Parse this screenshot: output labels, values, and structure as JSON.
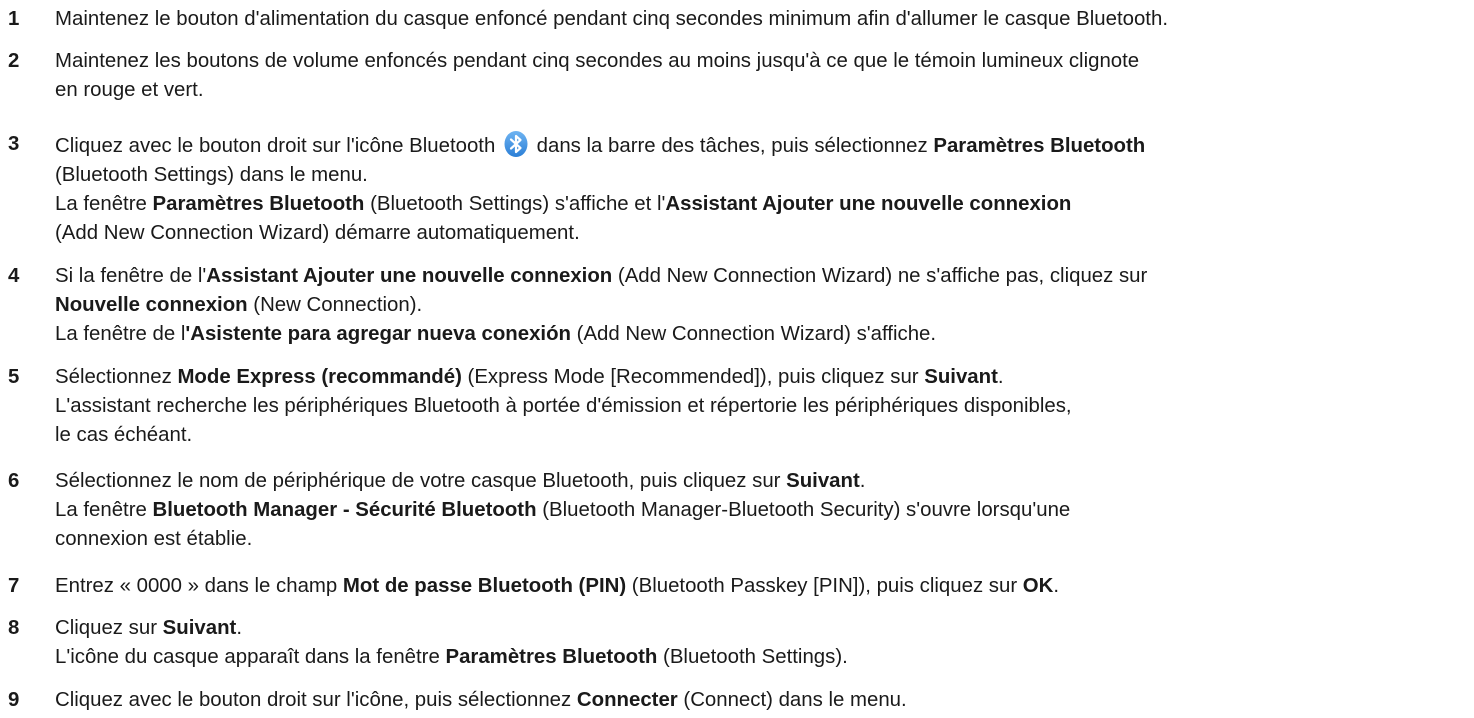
{
  "steps": [
    {
      "number": "1",
      "lines": [
        [
          {
            "t": "Maintenez le bouton d'alimentation du casque enfoncé pendant cinq secondes minimum afin d'allumer le casque Bluetooth."
          }
        ]
      ]
    },
    {
      "number": "2",
      "lines": [
        [
          {
            "t": "Maintenez les boutons de volume enfoncés pendant cinq secondes au moins jusqu'à ce que le témoin lumineux clignote"
          }
        ],
        [
          {
            "t": "en rouge et vert."
          }
        ]
      ]
    },
    {
      "number": "3",
      "lines": [
        [
          {
            "t": "Cliquez avec le bouton droit sur l'icône Bluetooth "
          },
          {
            "icon": "bluetooth-icon"
          },
          {
            "t": " dans la barre des tâches, puis sélectionnez "
          },
          {
            "t": "Paramètres Bluetooth",
            "b": true
          }
        ],
        [
          {
            "t": "(Bluetooth Settings) dans le menu."
          }
        ],
        [
          {
            "t": "La fenêtre "
          },
          {
            "t": "Paramètres Bluetooth",
            "b": true
          },
          {
            "t": " (Bluetooth Settings) s'affiche et l'"
          },
          {
            "t": "Assistant Ajouter une nouvelle connexion",
            "b": true
          }
        ],
        [
          {
            "t": "(Add New Connection Wizard) démarre automatiquement."
          }
        ]
      ]
    },
    {
      "number": "4",
      "lines": [
        [
          {
            "t": "Si la fenêtre de l'"
          },
          {
            "t": "Assistant Ajouter une nouvelle connexion",
            "b": true
          },
          {
            "t": " (Add New Connection Wizard) ne s'affiche pas, cliquez sur"
          }
        ],
        [
          {
            "t": "Nouvelle connexion",
            "b": true
          },
          {
            "t": " (New Connection)."
          }
        ],
        [
          {
            "t": "La fenêtre de l"
          },
          {
            "t": "'Asistente para agregar nueva conexión",
            "b": true
          },
          {
            "t": " (Add New Connection Wizard) s'affiche."
          }
        ]
      ]
    },
    {
      "number": "5",
      "lines": [
        [
          {
            "t": "Sélectionnez "
          },
          {
            "t": "Mode Express (recommandé)",
            "b": true
          },
          {
            "t": " (Express Mode [Recommended]), puis cliquez sur "
          },
          {
            "t": "Suivant",
            "b": true
          },
          {
            "t": "."
          }
        ],
        [
          {
            "t": "L'assistant recherche les périphériques Bluetooth à portée d'émission et répertorie les périphériques disponibles,"
          }
        ],
        [
          {
            "t": "le cas échéant."
          }
        ]
      ]
    },
    {
      "number": "6",
      "lines": [
        [
          {
            "t": "Sélectionnez le nom de périphérique de votre casque Bluetooth, puis cliquez sur "
          },
          {
            "t": "Suivant",
            "b": true
          },
          {
            "t": "."
          }
        ],
        [
          {
            "t": "La fenêtre "
          },
          {
            "t": "Bluetooth Manager - Sécurité Bluetooth",
            "b": true
          },
          {
            "t": " (Bluetooth Manager-Bluetooth Security) s'ouvre lorsqu'une"
          }
        ],
        [
          {
            "t": "connexion est établie."
          }
        ]
      ]
    },
    {
      "number": "7",
      "lines": [
        [
          {
            "t": "Entrez « 0000 » dans le champ "
          },
          {
            "t": "Mot de passe Bluetooth (PIN)",
            "b": true
          },
          {
            "t": " (Bluetooth Passkey [PIN]), puis cliquez sur "
          },
          {
            "t": "OK",
            "b": true
          },
          {
            "t": "."
          }
        ]
      ]
    },
    {
      "number": "8",
      "lines": [
        [
          {
            "t": "Cliquez sur "
          },
          {
            "t": "Suivant",
            "b": true
          },
          {
            "t": "."
          }
        ],
        [
          {
            "t": "L'icône du casque apparaît dans la fenêtre "
          },
          {
            "t": "Paramètres Bluetooth",
            "b": true
          },
          {
            "t": " (Bluetooth Settings)."
          }
        ]
      ]
    },
    {
      "number": "9",
      "lines": [
        [
          {
            "t": "Cliquez avec le bouton droit sur l'icône, puis sélectionnez "
          },
          {
            "t": "Connecter",
            "b": true
          },
          {
            "t": " (Connect) dans le menu."
          }
        ]
      ]
    }
  ],
  "colors": {
    "text": "#1a1a1a",
    "bluetooth_icon": "#2b7fd6"
  }
}
